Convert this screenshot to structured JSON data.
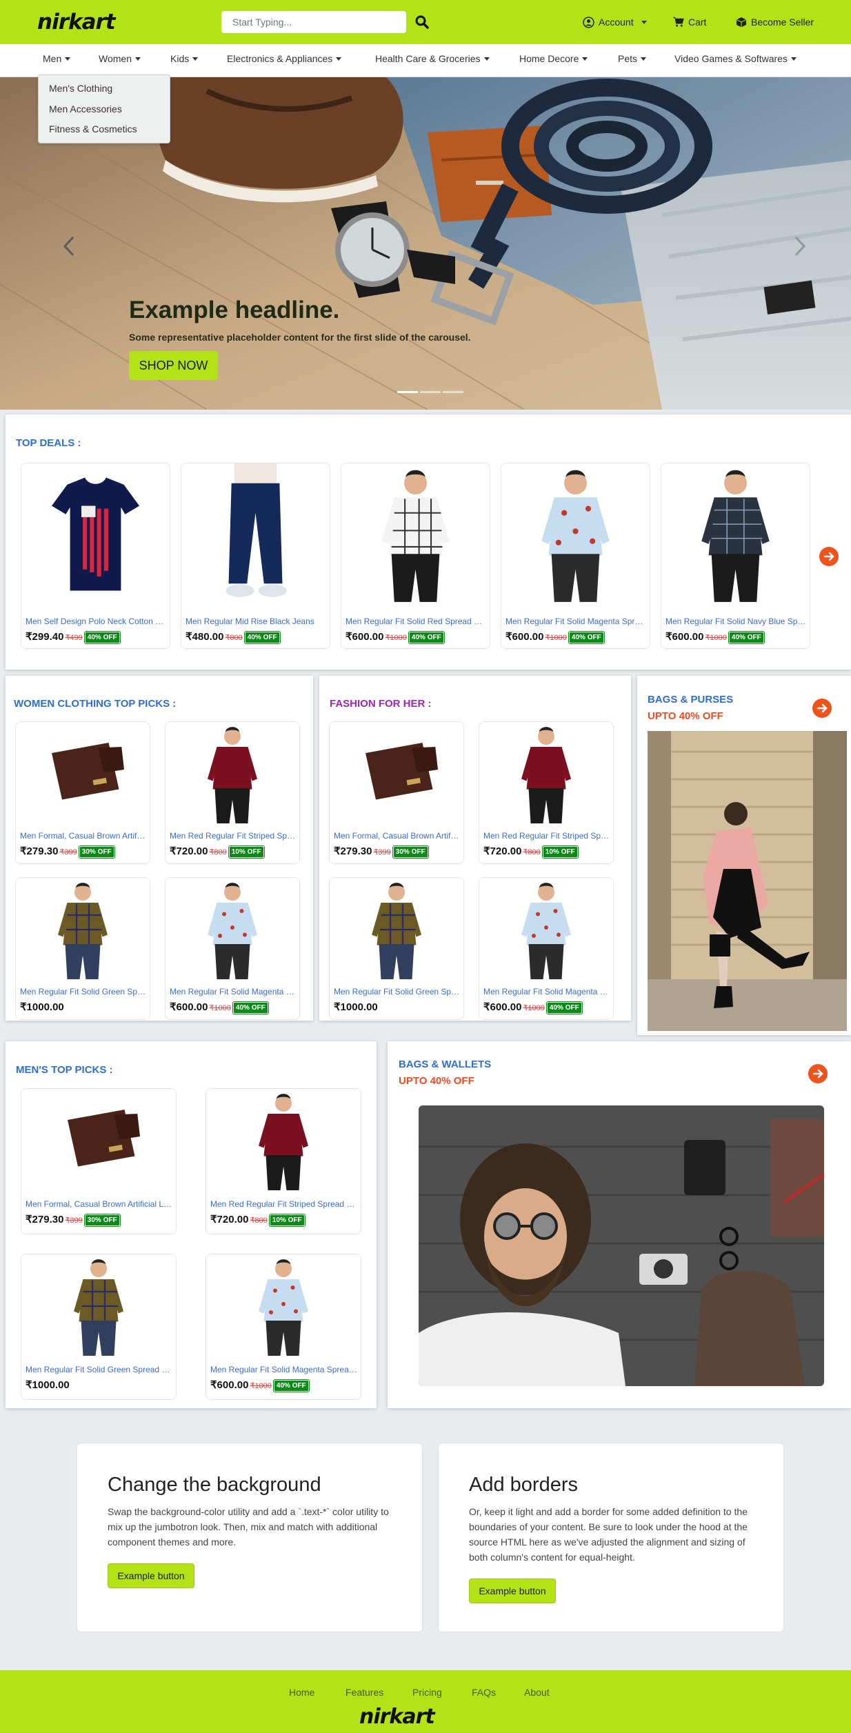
{
  "brand": {
    "logo_text": "nirkart",
    "accent": "#b3e316",
    "link_blue": "#2f6fd2",
    "sale_orange": "#f04a20",
    "discount_green": "#0c8a17"
  },
  "header": {
    "search_placeholder": "Start Typing...",
    "account_label": "Account",
    "cart_label": "Cart",
    "seller_label": "Become Seller"
  },
  "categories": {
    "men": "Men",
    "women": "Women",
    "kids": "Kids",
    "electronics": "Electronics & Appliances",
    "health": "Health Care & Groceries",
    "home": "Home Decore",
    "pets": "Pets",
    "games": "Video Games & Softwares"
  },
  "men_dropdown": [
    "Men's Clothing",
    "Men Accessories",
    "Fitness & Cosmetics"
  ],
  "hero": {
    "headline": "Example headline.",
    "subtext": "Some representative placeholder content for the first slide of the carousel.",
    "button": "SHOP NOW",
    "slide_count": 3,
    "active_slide": 1
  },
  "top_deals": {
    "title": "TOP DEALS :",
    "items": [
      {
        "name": "Men Self Design Polo Neck Cotton Blend T-Shirt",
        "price": "₹299.40",
        "old": "₹499",
        "off": "40% OFF"
      },
      {
        "name": "Men Regular Mid Rise Black Jeans",
        "price": "₹480.00",
        "old": "₹800",
        "off": "40% OFF"
      },
      {
        "name": "Men Regular Fit Solid Red Spread Collar Casual Shirt",
        "price": "₹600.00",
        "old": "₹1000",
        "off": "40% OFF"
      },
      {
        "name": "Men Regular Fit Solid Magenta Spread Collar Shirt",
        "price": "₹600.00",
        "old": "₹1000",
        "off": "40% OFF"
      },
      {
        "name": "Men Regular Fit Solid Navy Blue Spread Collar Shirt",
        "price": "₹600.00",
        "old": "₹1000",
        "off": "40% OFF"
      }
    ]
  },
  "women_picks": {
    "title": "WOMEN CLOTHING TOP PICKS :",
    "items": [
      {
        "name": "Men Formal, Casual Brown Artificial Leather Wallet",
        "price": "₹279.30",
        "old": "₹399",
        "off": "30% OFF"
      },
      {
        "name": "Men Red Regular Fit Striped Spread Collar Shirt",
        "price": "₹720.00",
        "old": "₹800",
        "off": "10% OFF"
      },
      {
        "name": "Men Regular Fit Solid Green Spread Collar Shirt",
        "price": "₹1000.00",
        "old": "",
        "off": ""
      },
      {
        "name": "Men Regular Fit Solid Magenta Spread Collar Shirt",
        "price": "₹600.00",
        "old": "₹1000",
        "off": "40% OFF"
      }
    ]
  },
  "fashion_her": {
    "title": "FASHION FOR HER :",
    "items": [
      {
        "name": "Men Formal, Casual Brown Artificial Leather Wallet",
        "price": "₹279.30",
        "old": "₹399",
        "off": "30% OFF"
      },
      {
        "name": "Men Red Regular Fit Striped Spread Collar Shirt",
        "price": "₹720.00",
        "old": "₹800",
        "off": "10% OFF"
      },
      {
        "name": "Men Regular Fit Solid Green Spread Collar Shirt",
        "price": "₹1000.00",
        "old": "",
        "off": ""
      },
      {
        "name": "Men Regular Fit Solid Magenta Spread Collar Shirt",
        "price": "₹600.00",
        "old": "₹1000",
        "off": "40% OFF"
      }
    ]
  },
  "bags_purses": {
    "title": "BAGS & PURSES",
    "subtitle": "UPTO 40% OFF"
  },
  "mens_picks": {
    "title": "MEN'S TOP PICKS :",
    "items": [
      {
        "name": "Men Formal, Casual Brown Artificial Leather Wallet",
        "price": "₹279.30",
        "old": "₹399",
        "off": "30% OFF"
      },
      {
        "name": "Men Red Regular Fit Striped Spread Collar Shirt",
        "price": "₹720.00",
        "old": "₹800",
        "off": "10% OFF"
      },
      {
        "name": "Men Regular Fit Solid Green Spread Collar Shirt",
        "price": "₹1000.00",
        "old": "",
        "off": ""
      },
      {
        "name": "Men Regular Fit Solid Magenta Spread Collar Shirt",
        "price": "₹600.00",
        "old": "₹1000",
        "off": "40% OFF"
      }
    ]
  },
  "bags_wallets": {
    "title": "BAGS & WALLETS",
    "subtitle": "UPTO 40% OFF"
  },
  "jumbotrons": [
    {
      "title": "Change the background",
      "text": "Swap the background-color utility and add a `.text-*` color utility to mix up the jumbotron look. Then, mix and match with additional component themes and more.",
      "button": "Example button"
    },
    {
      "title": "Add borders",
      "text": "Or, keep it light and add a border for some added definition to the boundaries of your content. Be sure to look under the hood at the source HTML here as we've adjusted the alignment and sizing of both column's content for equal-height.",
      "button": "Example button"
    }
  ],
  "footer": {
    "links": [
      "Home",
      "Features",
      "Pricing",
      "FAQs",
      "About"
    ],
    "logo_text": "nirkart"
  }
}
